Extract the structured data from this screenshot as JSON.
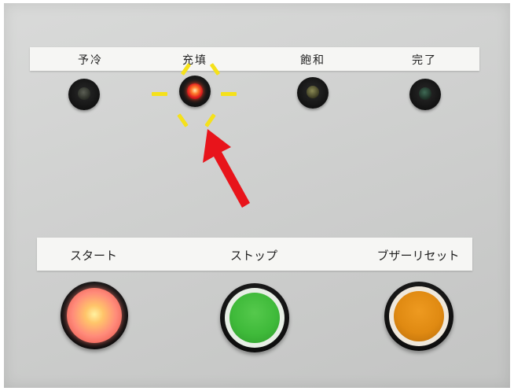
{
  "indicator_labels": {
    "precool": "予冷",
    "filling": "充填",
    "saturated": "飽和",
    "complete": "完了"
  },
  "button_labels": {
    "start": "スタート",
    "stop": "ストップ",
    "buzzer_reset": "ブザーリセット"
  },
  "indicator_states": {
    "precool": "off",
    "filling": "on",
    "saturated": "off",
    "complete": "off"
  },
  "colors": {
    "panel": "#cfd0cf",
    "label_strip": "#f6f6f4",
    "start_button": "#ff8b7a",
    "stop_button": "#3fba3a",
    "buzzer_reset_button": "#e08a12",
    "filling_lamp": "#e02020",
    "highlight_rays": "#f5e11a",
    "arrow": "#e8141b"
  },
  "icons": {
    "arrow": "red-arrow-pointing-at-filling-lamp",
    "highlight": "yellow-sparkle-rays"
  }
}
